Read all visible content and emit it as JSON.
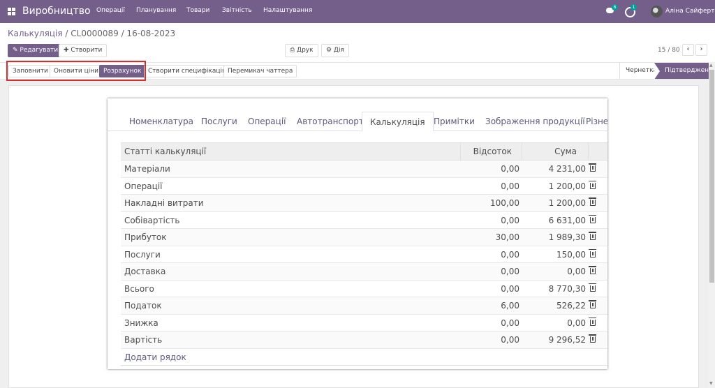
{
  "navbar": {
    "app_title": "Виробництво",
    "menu": [
      "Операції",
      "Планування",
      "Товари",
      "Звітність",
      "Налаштування"
    ],
    "chat_count": "6",
    "activity_count": "1",
    "user_name": "Аліна Сайферт"
  },
  "breadcrumb": {
    "parent": "Калькуляція",
    "separator": " / ",
    "current": "CL0000089 / 16-08-2023"
  },
  "toolbar": {
    "edit_label": "✎ Редагувати",
    "create_label": "✚ Створити",
    "print_label": "⎙ Друк",
    "action_label": "⚙ Дія",
    "pager": "15 / 80",
    "prev": "‹",
    "next": "›"
  },
  "statusbar": {
    "buttons": [
      "Заповнити",
      "Оновити ціни",
      "Розрахунок",
      "Створити специфікацію",
      "Перемикач чаттера"
    ],
    "active_button": "Розрахунок",
    "stages": [
      "Чернетка",
      "Підтверджено"
    ],
    "current_stage": "Підтверджено"
  },
  "notebook": {
    "tabs": [
      "Номенклатура",
      "Послуги",
      "Операції",
      "Автотранспорт",
      "Калькуляція",
      "Примітки",
      "Зображення продукції",
      "Різне"
    ],
    "active_tab": "Калькуляція"
  },
  "table": {
    "headers": {
      "name": "Статті калькуляції",
      "percent": "Відсоток",
      "sum": "Сума"
    },
    "rows": [
      {
        "name": "Матеріали",
        "percent": "0,00",
        "sum": "4 231,00"
      },
      {
        "name": "Операції",
        "percent": "0,00",
        "sum": "1 200,00"
      },
      {
        "name": "Накладні витрати",
        "percent": "100,00",
        "sum": "1 200,00"
      },
      {
        "name": "Собівартість",
        "percent": "0,00",
        "sum": "6 631,00"
      },
      {
        "name": "Прибуток",
        "percent": "30,00",
        "sum": "1 989,30"
      },
      {
        "name": "Послуги",
        "percent": "0,00",
        "sum": "150,00"
      },
      {
        "name": "Доставка",
        "percent": "0,00",
        "sum": "0,00"
      },
      {
        "name": "Всього",
        "percent": "0,00",
        "sum": "8 770,30"
      },
      {
        "name": "Податок",
        "percent": "6,00",
        "sum": "526,22"
      },
      {
        "name": "Знижка",
        "percent": "0,00",
        "sum": "0,00"
      },
      {
        "name": "Вартість",
        "percent": "0,00",
        "sum": "9 296,52"
      }
    ],
    "add_line_label": "Додати рядок"
  },
  "colors": {
    "primary": "#735f8a",
    "highlight": "#d32f2f"
  }
}
